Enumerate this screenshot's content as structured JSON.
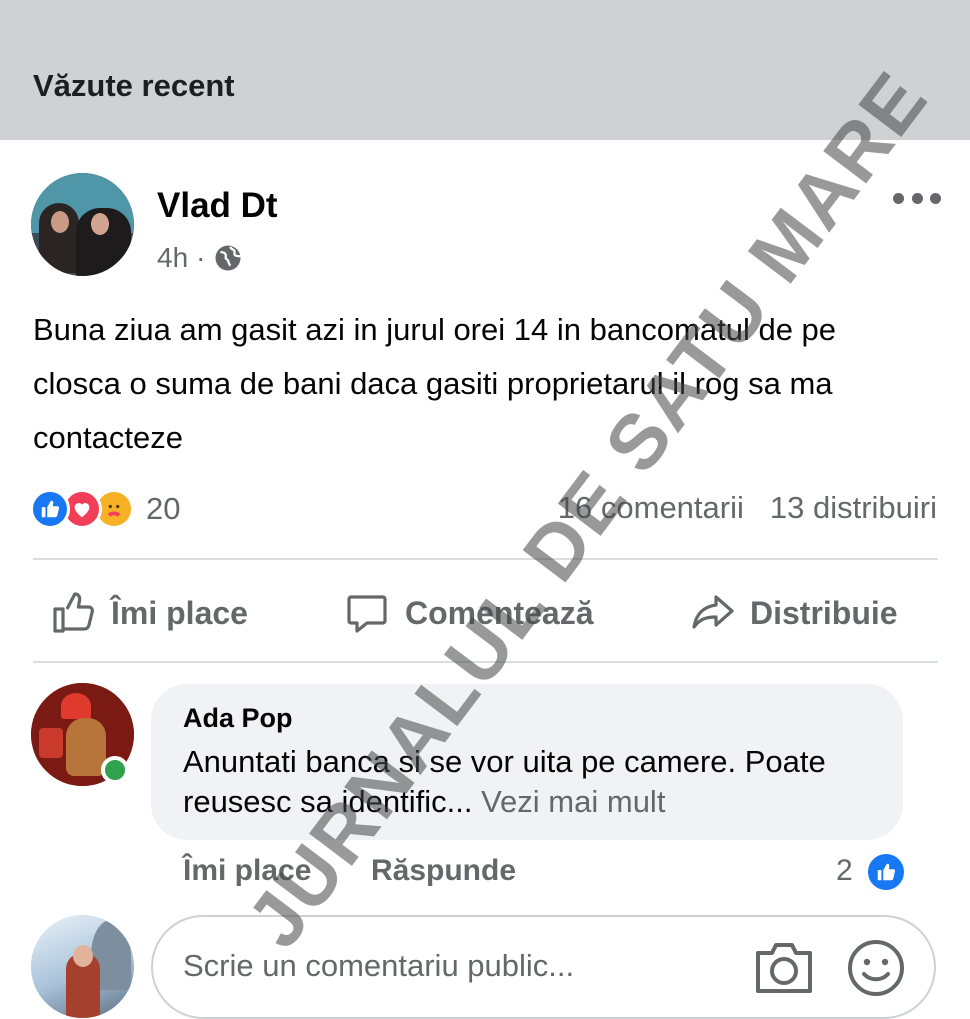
{
  "header": {
    "title": "Văzute recent"
  },
  "post": {
    "author": "Vlad Dt",
    "time": "4h",
    "separator": "·",
    "text": "Buna ziua am gasit azi in jurul orei 14 in bancomatul de pe closca o suma de bani  daca gasiti proprietarul il rog sa ma contacteze",
    "reaction_count": "20",
    "comments_count": "16 comentarii",
    "shares_count": "13 distribuiri"
  },
  "actions": {
    "like_label": "Îmi place",
    "comment_label": "Comentează",
    "share_label": "Distribuie"
  },
  "comment": {
    "author": "Ada Pop",
    "text": "Anuntati banca si se vor uita pe camere. Poate reusesc sa identific...",
    "see_more": "Vezi mai mult",
    "like_label": "Îmi place",
    "reply_label": "Răspunde",
    "like_count": "2"
  },
  "composer": {
    "placeholder": "Scrie un comentariu public..."
  },
  "watermark": "JURNALUL DE SATU MARE",
  "colors": {
    "like_blue": "#1877f2",
    "love_red": "#f33e58",
    "care_yellow": "#f7b125",
    "online_green": "#31a24c"
  }
}
